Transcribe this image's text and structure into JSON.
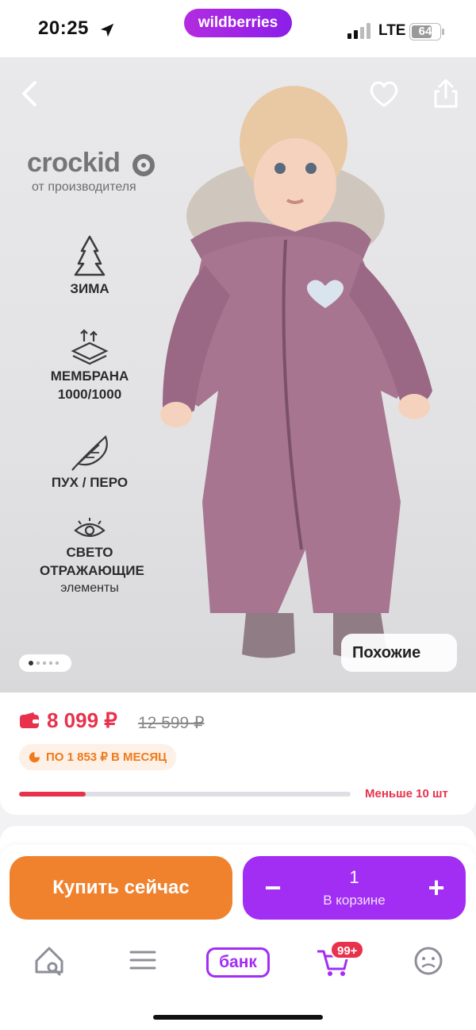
{
  "status_bar": {
    "time": "20:25",
    "app_badge": "wildberries",
    "network": "LTE",
    "battery": "64"
  },
  "hero": {
    "brand": "crockid",
    "brand_sub": "от производителя",
    "features": [
      {
        "icon": "winter-icon",
        "label": "ЗИМА"
      },
      {
        "icon": "membrane-icon",
        "label": "МЕМБРАНА 1000/1000"
      },
      {
        "icon": "feather-icon",
        "label": "ПУХ / ПЕРО"
      },
      {
        "icon": "eye-icon",
        "label": "СВЕТО ОТРАЖАЮЩИЕ",
        "sub": "элементы"
      }
    ],
    "similar_label": "Похожие",
    "image_count": 5,
    "active_image": 1
  },
  "price": {
    "current": "8 099 ₽",
    "old": "12 599 ₽",
    "installment": "ПО 1 853 ₽ В МЕСЯЦ",
    "stock_text": "Меньше 10 шт",
    "stock_level": 0.2
  },
  "actions": {
    "buy_now": "Купить сейчас",
    "quantity": "1",
    "in_cart": "В корзине",
    "minus": "−",
    "plus": "+"
  },
  "nav": {
    "bank": "банк",
    "cart_badge": "99+"
  },
  "colors": {
    "accent": "#a22ef4",
    "buy": "#f0822e",
    "price": "#e8324c"
  }
}
